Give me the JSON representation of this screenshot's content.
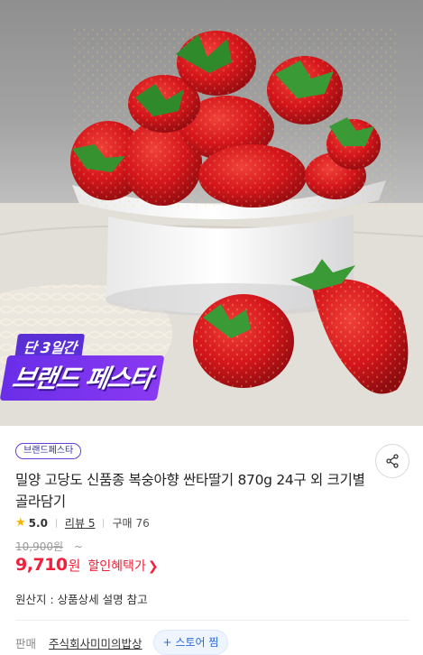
{
  "promo": {
    "top_text": "단 3일간",
    "main_text": "브랜드 페스타"
  },
  "product": {
    "badge": "브랜드페스타",
    "title": "밀양 고당도 신품종 복숭아향 싼타딸기 870g 24구 외 크기별 골라담기",
    "rating": "5.0",
    "review_label": "리뷰 5",
    "purchase_label": "구매",
    "purchase_count": "76",
    "original_price": "10,900원",
    "original_tilde": "~",
    "price": "9,710",
    "price_unit": "원",
    "discount_link": "할인혜택가",
    "origin_text": "원산지 : 상품상세 설명 참고",
    "seller_label": "판매",
    "seller_name": "주식회사미미의밥상",
    "store_button": "+ 스토어 찜"
  },
  "icons": {
    "share": "share-icon",
    "star": "star-icon",
    "chevron": "chevron-right-icon"
  },
  "colors": {
    "price_red": "#f0203a",
    "brand_purple": "#6340d6",
    "star_yellow": "#f6b400",
    "store_blue": "#2d6ad6"
  }
}
